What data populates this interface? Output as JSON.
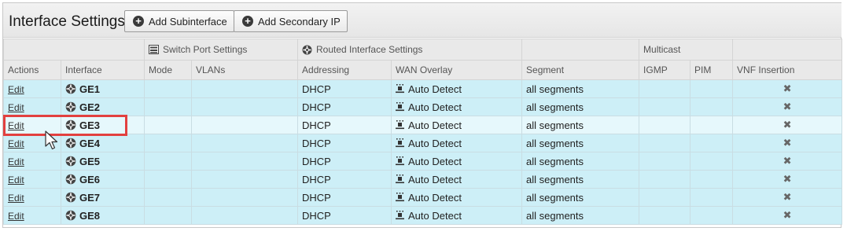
{
  "header": {
    "title": "Interface Settings",
    "add_subinterface_label": "Add Subinterface",
    "add_secondary_ip_label": "Add Secondary IP"
  },
  "groups": {
    "switch_port": "Switch Port Settings",
    "routed_interface": "Routed Interface Settings",
    "multicast": "Multicast"
  },
  "columns": {
    "actions": "Actions",
    "interface": "Interface",
    "mode": "Mode",
    "vlans": "VLANs",
    "addressing": "Addressing",
    "wan_overlay": "WAN Overlay",
    "segment": "Segment",
    "igmp": "IGMP",
    "pim": "PIM",
    "vnf_insertion": "VNF Insertion"
  },
  "rows": [
    {
      "action": "Edit",
      "interface": "GE1",
      "addressing": "DHCP",
      "wan_overlay": "Auto Detect",
      "segment": "all segments",
      "vnf": "✖"
    },
    {
      "action": "Edit",
      "interface": "GE2",
      "addressing": "DHCP",
      "wan_overlay": "Auto Detect",
      "segment": "all segments",
      "vnf": "✖"
    },
    {
      "action": "Edit",
      "interface": "GE3",
      "addressing": "DHCP",
      "wan_overlay": "Auto Detect",
      "segment": "all segments",
      "vnf": "✖"
    },
    {
      "action": "Edit",
      "interface": "GE4",
      "addressing": "DHCP",
      "wan_overlay": "Auto Detect",
      "segment": "all segments",
      "vnf": "✖"
    },
    {
      "action": "Edit",
      "interface": "GE5",
      "addressing": "DHCP",
      "wan_overlay": "Auto Detect",
      "segment": "all segments",
      "vnf": "✖"
    },
    {
      "action": "Edit",
      "interface": "GE6",
      "addressing": "DHCP",
      "wan_overlay": "Auto Detect",
      "segment": "all segments",
      "vnf": "✖"
    },
    {
      "action": "Edit",
      "interface": "GE7",
      "addressing": "DHCP",
      "wan_overlay": "Auto Detect",
      "segment": "all segments",
      "vnf": "✖"
    },
    {
      "action": "Edit",
      "interface": "GE8",
      "addressing": "DHCP",
      "wan_overlay": "Auto Detect",
      "segment": "all segments",
      "vnf": "✖"
    }
  ],
  "icons": {
    "add": "plus-circle-icon",
    "switch_port": "switch-icon",
    "routed": "router-icon",
    "interface": "router-icon",
    "wan": "auto-detect-icon",
    "vnf": "x-icon"
  },
  "colors": {
    "row_bg": "#cdeff7",
    "highlight_border": "#e2403f"
  }
}
